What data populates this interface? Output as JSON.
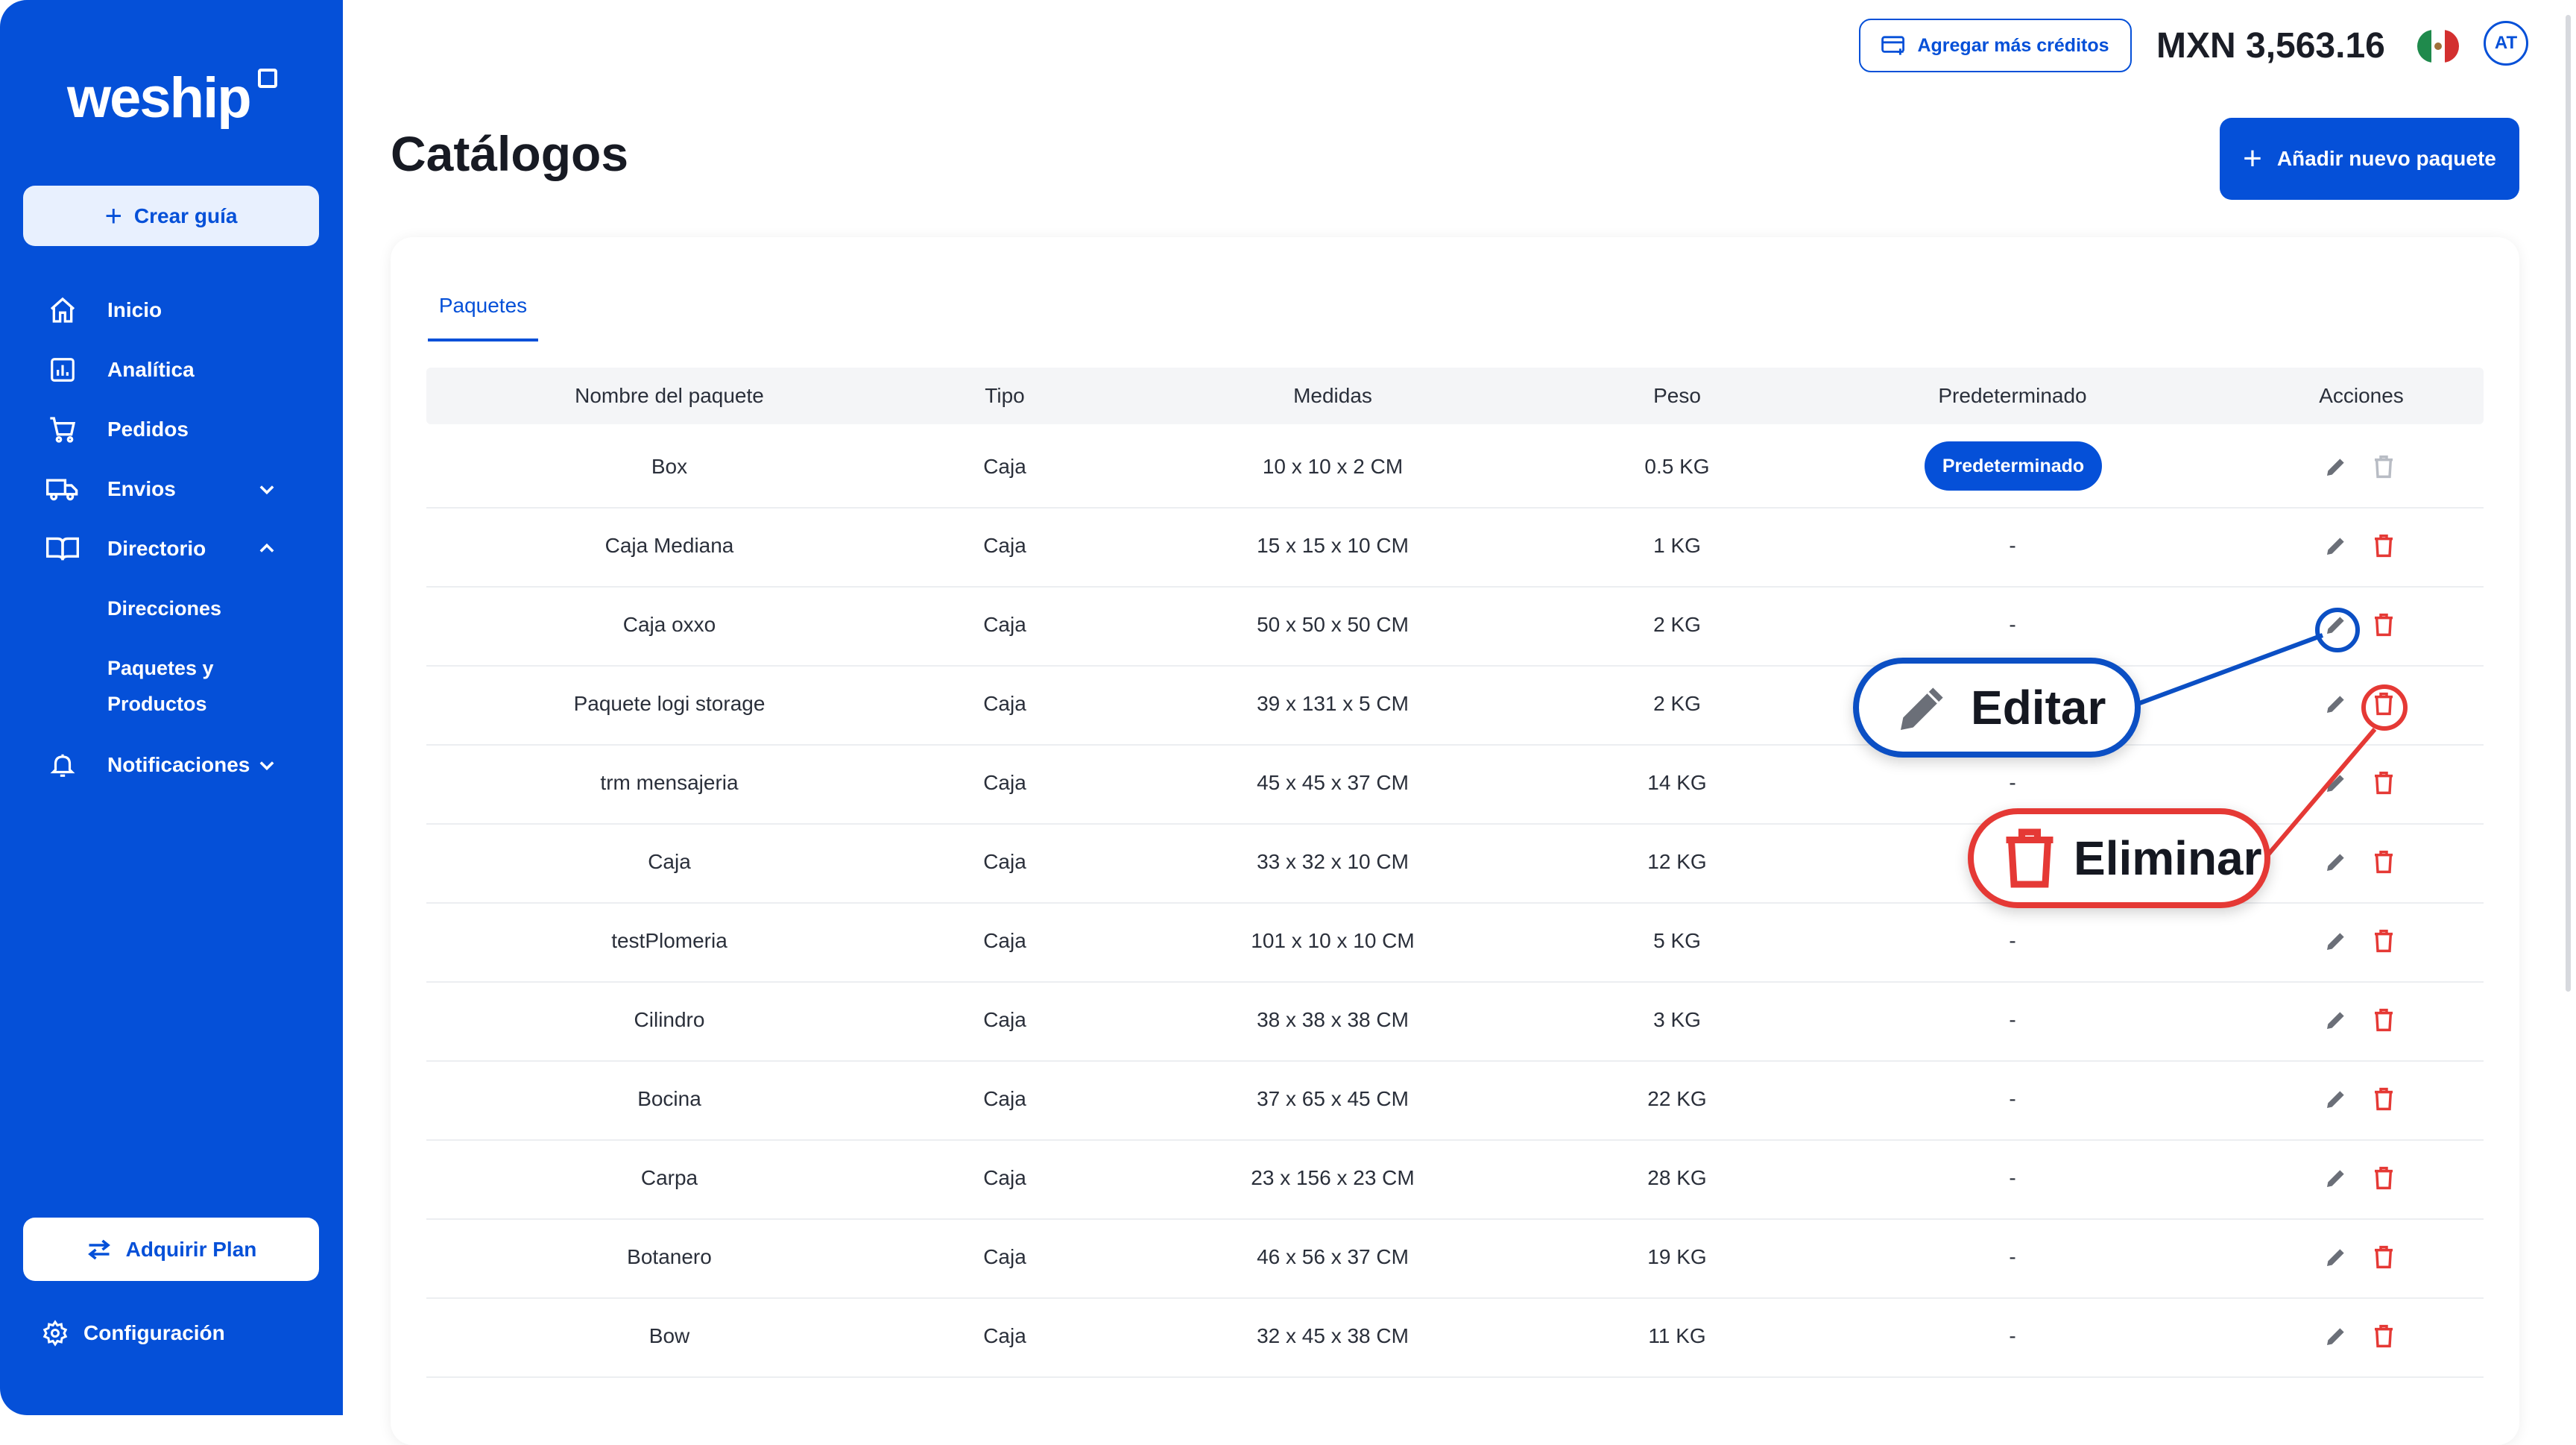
{
  "brand": {
    "name": "weship"
  },
  "sidebar": {
    "create_label": "Crear guía",
    "items": [
      {
        "label": "Inicio",
        "icon": "home-icon"
      },
      {
        "label": "Analítica",
        "icon": "analytics-icon"
      },
      {
        "label": "Pedidos",
        "icon": "cart-icon"
      },
      {
        "label": "Envios",
        "icon": "truck-icon",
        "expandable": true,
        "expanded": false
      },
      {
        "label": "Directorio",
        "icon": "book-icon",
        "expandable": true,
        "expanded": true
      },
      {
        "label": "Notificaciones",
        "icon": "bell-icon",
        "expandable": true,
        "expanded": false
      }
    ],
    "subitems": [
      "Direcciones",
      "Paquetes y",
      "Productos"
    ],
    "plan_label": "Adquirir Plan",
    "config_label": "Configuración"
  },
  "header": {
    "credits_label": "Agregar más créditos",
    "balance": "MXN 3,563.16",
    "flag": "mexico-flag-icon",
    "avatar_initials": "AT"
  },
  "page": {
    "title": "Catálogos",
    "add_button": "Añadir nuevo paquete",
    "tab": "Paquetes"
  },
  "table": {
    "headers": [
      "Nombre del paquete",
      "Tipo",
      "Medidas",
      "Peso",
      "Predeterminado",
      "Acciones"
    ],
    "rows": [
      {
        "name": "Box",
        "type": "Caja",
        "size": "10 x 10 x 2 CM",
        "weight": "0.5 KG",
        "default": "Predeterminado"
      },
      {
        "name": "Caja Mediana",
        "type": "Caja",
        "size": "15 x 15 x 10 CM",
        "weight": "1 KG",
        "default": "-"
      },
      {
        "name": "Caja oxxo",
        "type": "Caja",
        "size": "50 x 50 x 50 CM",
        "weight": "2 KG",
        "default": "-"
      },
      {
        "name": "Paquete logi storage",
        "type": "Caja",
        "size": "39 x 131 x 5 CM",
        "weight": "2 KG",
        "default": ""
      },
      {
        "name": "trm mensajeria",
        "type": "Caja",
        "size": "45 x 45 x 37 CM",
        "weight": "14 KG",
        "default": "-"
      },
      {
        "name": "Caja",
        "type": "Caja",
        "size": "33 x 32 x 10 CM",
        "weight": "12 KG",
        "default": ""
      },
      {
        "name": "testPlomeria",
        "type": "Caja",
        "size": "101 x 10 x 10 CM",
        "weight": "5 KG",
        "default": "-"
      },
      {
        "name": "Cilindro",
        "type": "Caja",
        "size": "38 x 38 x 38 CM",
        "weight": "3 KG",
        "default": "-"
      },
      {
        "name": "Bocina",
        "type": "Caja",
        "size": "37 x 65 x 45 CM",
        "weight": "22 KG",
        "default": "-"
      },
      {
        "name": "Carpa",
        "type": "Caja",
        "size": "23 x 156 x 23 CM",
        "weight": "28 KG",
        "default": "-"
      },
      {
        "name": "Botanero",
        "type": "Caja",
        "size": "46 x 56 x 37 CM",
        "weight": "19 KG",
        "default": "-"
      },
      {
        "name": "Bow",
        "type": "Caja",
        "size": "32 x 45 x 38 CM",
        "weight": "11 KG",
        "default": "-"
      }
    ]
  },
  "callouts": {
    "edit": "Editar",
    "delete": "Eliminar"
  },
  "colors": {
    "primary": "#0550d8",
    "danger": "#e53935",
    "edit_callout": "#0b4fc4"
  }
}
